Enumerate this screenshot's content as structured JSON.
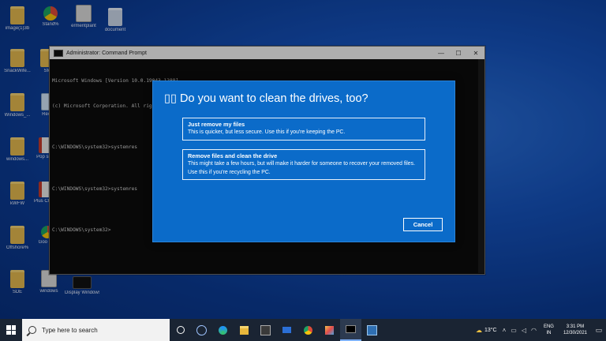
{
  "desktop": {
    "icons": [
      {
        "label": "image(1)3b",
        "kind": "folder"
      },
      {
        "label": "Stand%",
        "kind": "chrome"
      },
      {
        "label": "ermentplant",
        "kind": "doc"
      },
      {
        "label": "document",
        "kind": "folder-white"
      },
      {
        "label": "SnackWife...",
        "kind": "folder"
      },
      {
        "label": "Sfo",
        "kind": "folder"
      },
      {
        "label": "Windows_...",
        "kind": "folder"
      },
      {
        "label": "Recy",
        "kind": "bin"
      },
      {
        "label": "windows...",
        "kind": "folder"
      },
      {
        "label": "Pop slides",
        "kind": "pdf"
      },
      {
        "label": "kWFW",
        "kind": "folder"
      },
      {
        "label": "Plus Choose",
        "kind": "pdf"
      },
      {
        "label": "Offshore%",
        "kind": "folder"
      },
      {
        "label": "Goo Chr",
        "kind": "chrome"
      },
      {
        "label": "SDE",
        "kind": "folder"
      },
      {
        "label": "windows",
        "kind": "doc"
      },
      {
        "label": "Display Windows10...",
        "kind": "exe"
      }
    ]
  },
  "cmd": {
    "title": "Administrator: Command Prompt",
    "lines": [
      "Microsoft Windows [Version 10.0.19043.1288]",
      "(c) Microsoft Corporation. All rights reserved.",
      "",
      "C:\\WINDOWS\\system32>systemres",
      "",
      "C:\\WINDOWS\\system32>systemres",
      "",
      "C:\\WINDOWS\\system32>"
    ],
    "buttons": {
      "minimize": "—",
      "maximize": "☐",
      "close": "✕"
    }
  },
  "dialog": {
    "title": "Do you want to clean the drives, too?",
    "title_icon": "▯▯",
    "options": [
      {
        "heading": "Just remove my files",
        "desc": "This is quicker, but less secure. Use this if you're keeping the PC."
      },
      {
        "heading": "Remove files and clean the drive",
        "desc": "This might take a few hours, but will make it harder for someone to recover your removed files. Use this if you're recycling the PC."
      }
    ],
    "cancel_label": "Cancel"
  },
  "taskbar": {
    "search_placeholder": "Type here to search",
    "weather": "13°C",
    "lang_top": "ENG",
    "lang_bottom": "IN",
    "time": "3:31 PM",
    "date": "12/30/2021"
  },
  "colors": {
    "dialog_bg": "#0b6bc9",
    "taskbar_bg": "#1a2433"
  }
}
